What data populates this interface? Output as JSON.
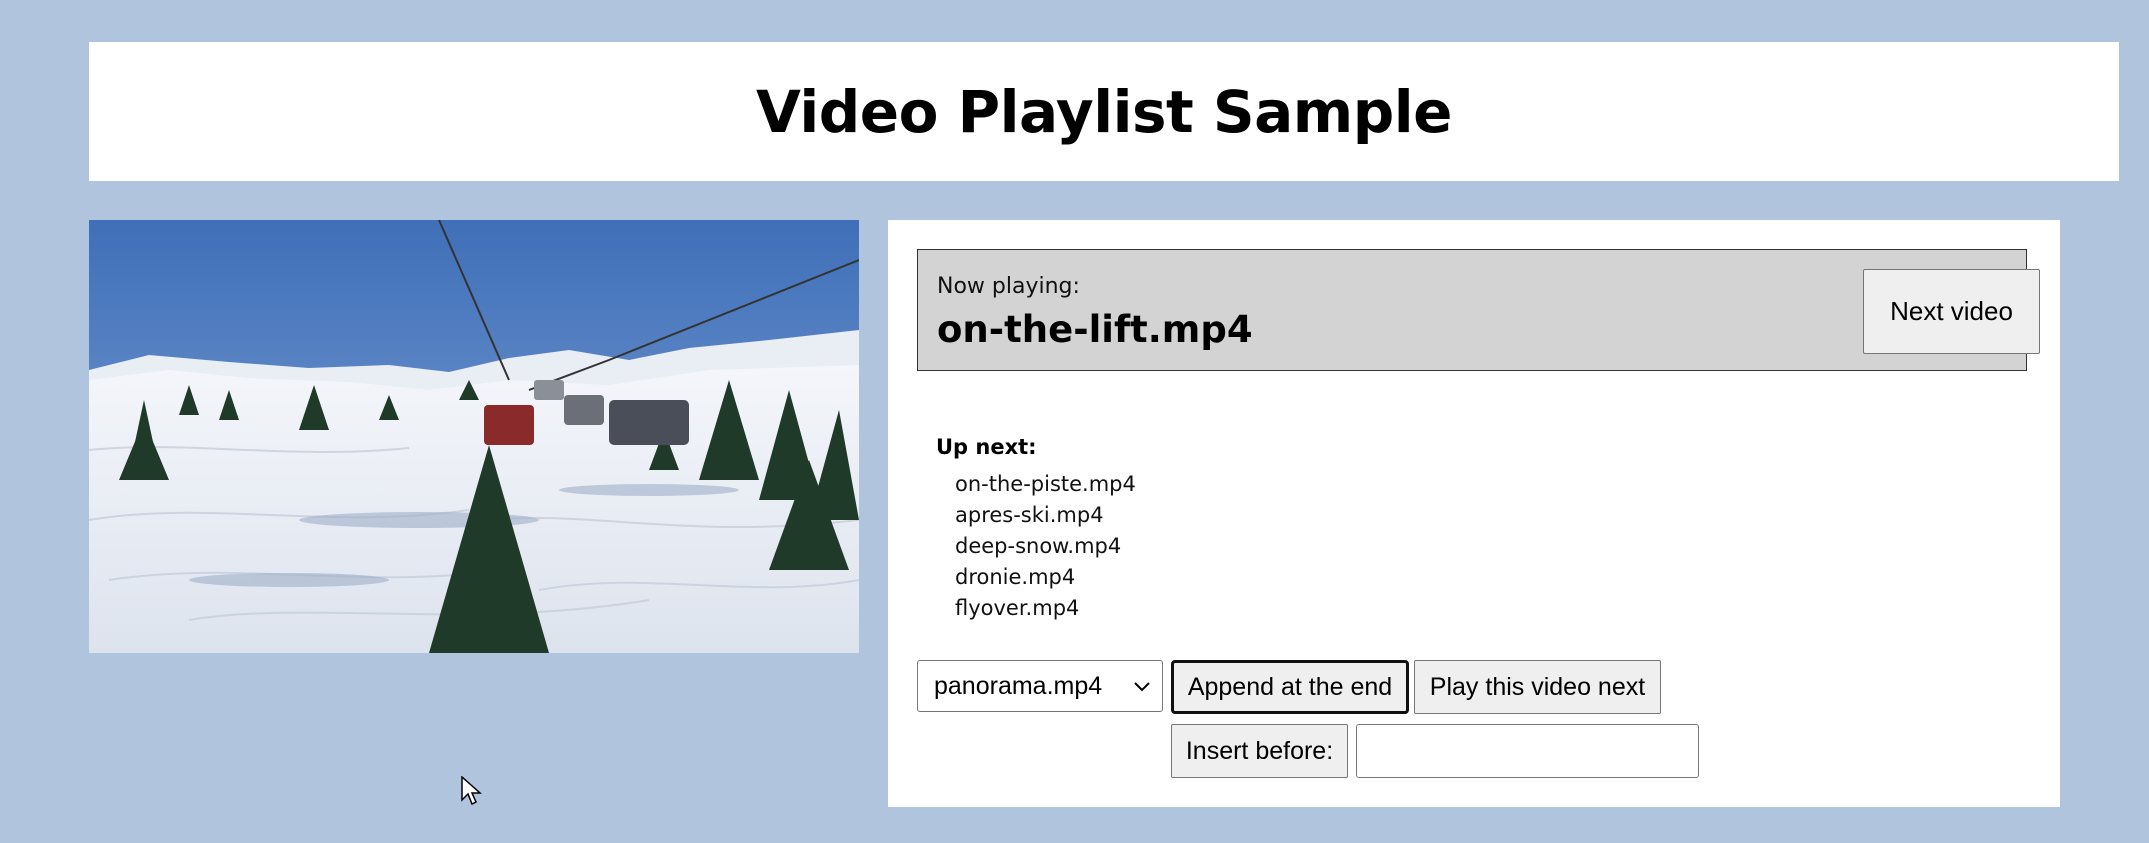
{
  "page": {
    "title": "Video Playlist Sample"
  },
  "now_playing": {
    "label": "Now playing:",
    "file": "on-the-lift.mp4",
    "next_button": "Next video"
  },
  "up_next": {
    "label": "Up next:",
    "items": [
      "on-the-piste.mp4",
      "apres-ski.mp4",
      "deep-snow.mp4",
      "dronie.mp4",
      "flyover.mp4"
    ]
  },
  "controls": {
    "select_value": "panorama.mp4",
    "append_label": "Append at the end",
    "play_next_label": "Play this video next",
    "insert_label": "Insert before:",
    "insert_value": ""
  },
  "colors": {
    "background": "#b0c4de",
    "panel": "#ffffff",
    "now_playing_box": "#d3d3d3"
  }
}
